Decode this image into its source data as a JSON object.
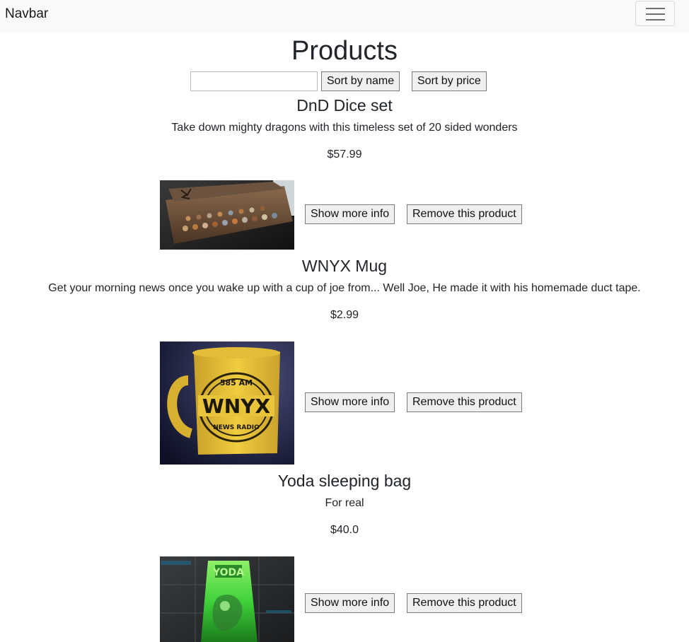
{
  "navbar": {
    "brand": "Navbar"
  },
  "page": {
    "title": "Products"
  },
  "controls": {
    "search_value": "",
    "search_placeholder": "",
    "sort_by_name_label": "Sort by name",
    "sort_by_price_label": "Sort by price"
  },
  "products": [
    {
      "name": "DnD Dice set",
      "description": "Take down mighty dragons with this timeless set of 20 sided wonders",
      "price": "$57.99",
      "image_subject": "dice-box-image",
      "more_info_label": "Show more info",
      "remove_label": "Remove this product"
    },
    {
      "name": "WNYX Mug",
      "description": "Get your morning news once you wake up with a cup of joe from... Well Joe, He made it with his homemade duct tape.",
      "price": "$2.99",
      "image_subject": "mug-image",
      "image_text_top": "585 AM",
      "image_text_main": "WNYX",
      "image_text_bottom": "NEWS RADIO",
      "more_info_label": "Show more info",
      "remove_label": "Remove this product"
    },
    {
      "name": "Yoda sleeping bag",
      "description": "For real",
      "price": "$40.0",
      "image_subject": "sleeping-bag-image",
      "image_text_main": "YODA",
      "more_info_label": "Show more info",
      "remove_label": "Remove this product"
    }
  ],
  "colors": {
    "navbar_bg": "#f8f9fa",
    "button_bg": "#efefef",
    "mug_yellow": "#e9c233",
    "mug_bg": "#1a1c3a",
    "yoda_green": "#3fd23a"
  }
}
